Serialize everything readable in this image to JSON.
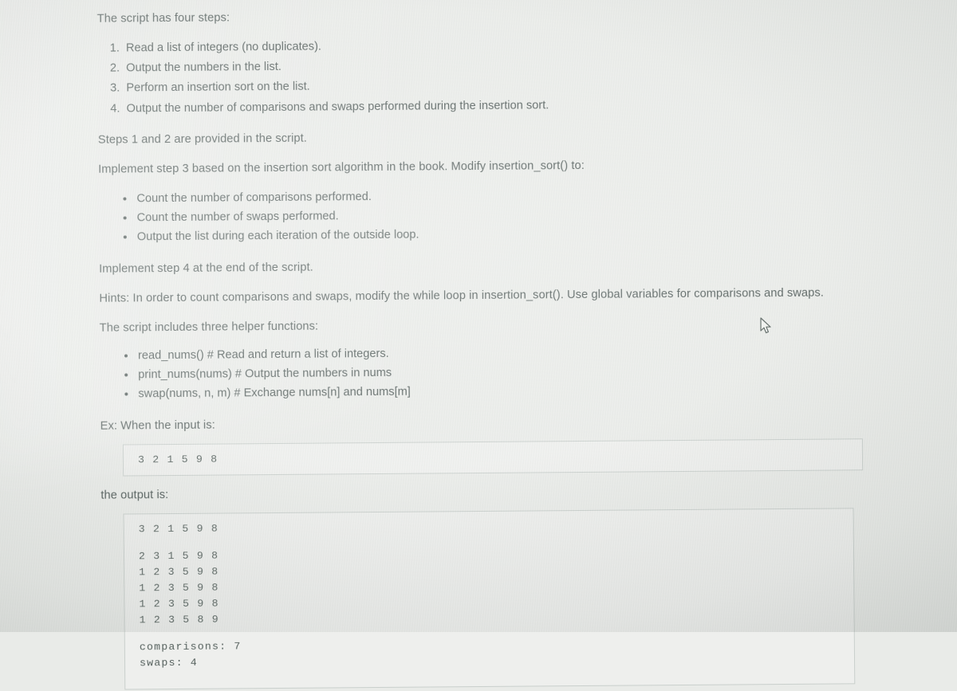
{
  "document": {
    "intro": "The script has four steps:",
    "steps": [
      "Read a list of integers (no duplicates).",
      "Output the numbers in the list.",
      "Perform an insertion sort on the list.",
      "Output the number of comparisons and swaps performed during the insertion sort."
    ],
    "provided_note": "Steps 1 and 2 are provided in the script.",
    "implement_step3": "Implement step 3 based on the insertion sort algorithm in the book. Modify insertion_sort() to:",
    "step3_requirements": [
      "Count the number of comparisons performed.",
      "Count the number of swaps performed.",
      "Output the list during each iteration of the outside loop."
    ],
    "implement_step4": "Implement step 4 at the end of the script.",
    "hints": "Hints: In order to count comparisons and swaps, modify the while loop in insertion_sort(). Use global variables for comparisons and swaps.",
    "helpers_intro": "The script includes three helper functions:",
    "helper_functions": [
      "read_nums() # Read and return a list of integers.",
      "print_nums(nums) # Output the numbers in nums",
      "swap(nums, n, m) # Exchange nums[n] and nums[m]"
    ],
    "example_input_label": "Ex: When the input is:",
    "example_input": "3 2 1 5 9 8",
    "example_output_label": "the output is:",
    "example_output_lines": [
      "3 2 1 5 9 8",
      "",
      "2 3 1 5 9 8",
      "1 2 3 5 9 8",
      "1 2 3 5 9 8",
      "1 2 3 5 9 8",
      "1 2 3 5 8 9",
      "",
      "comparisons: 7",
      "swaps: 4"
    ]
  },
  "pointer": {
    "icon": "mouse-cursor-arrow"
  },
  "colors": {
    "background": "#e9ebe8",
    "body_text": "#4b5654",
    "code_text": "#55605d",
    "box_border": "#c9cfcc"
  }
}
